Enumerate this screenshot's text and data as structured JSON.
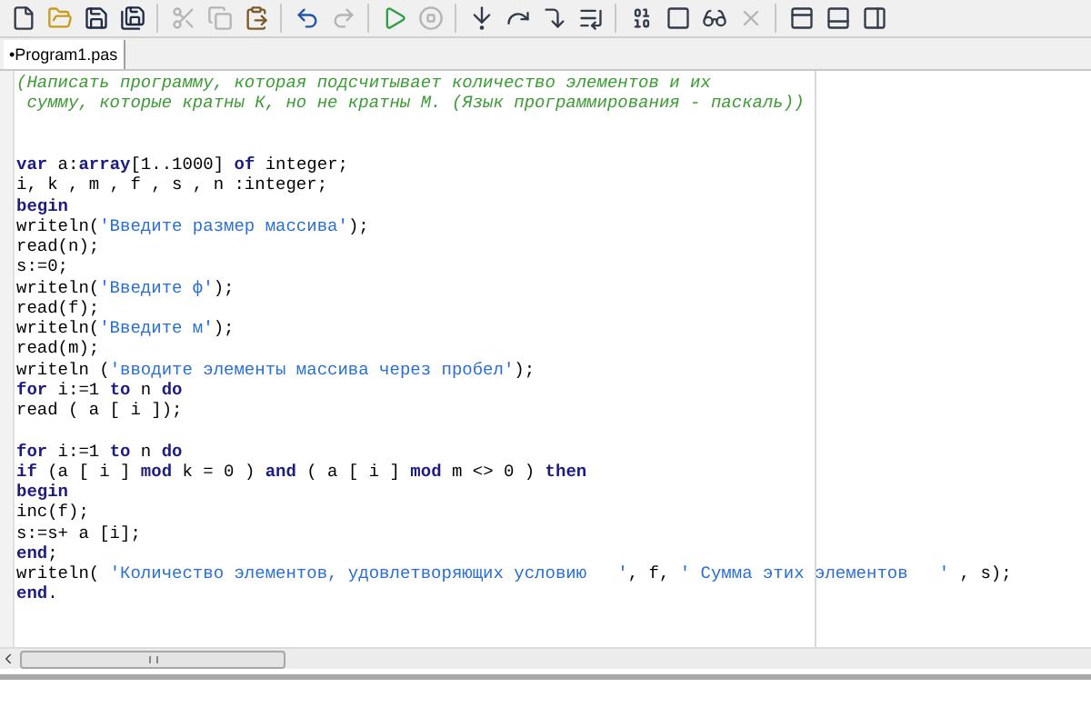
{
  "toolbar": [
    {
      "disabled": false
    },
    {
      "disabled": false
    },
    {
      "disabled": false
    },
    {
      "disabled": false
    },
    {
      "disabled": true
    },
    {
      "disabled": true
    },
    {
      "disabled": false
    },
    {
      "disabled": false
    },
    {
      "disabled": true
    },
    {
      "disabled": false
    },
    {
      "disabled": true
    },
    {
      "disabled": false
    },
    {
      "disabled": false
    },
    {
      "disabled": false
    },
    {
      "disabled": false
    },
    {
      "disabled": false
    },
    {
      "disabled": false
    },
    {
      "disabled": false
    },
    {
      "disabled": true
    },
    {
      "disabled": false
    },
    {
      "disabled": false
    },
    {
      "disabled": false
    }
  ],
  "tabs": [
    {
      "label": "•Program1.pas",
      "selected": true
    }
  ],
  "editor": {
    "lines": [
      {
        "kind": "code",
        "tokens": [
          {
            "kind": "comment",
            "text": "(Написать программу, которая подсчитывает количество элементов и их"
          }
        ]
      },
      {
        "kind": "code",
        "tokens": [
          {
            "kind": "comment",
            "text": " сумму, которые кратны К, но не кратны М. (Язык программирования - паскаль))"
          }
        ]
      },
      {
        "kind": "blank"
      },
      {
        "kind": "blank"
      },
      {
        "kind": "code",
        "tokens": [
          {
            "kind": "keyword",
            "text": "var"
          },
          {
            "kind": "plain",
            "text": " a:"
          },
          {
            "kind": "keyword",
            "text": "array"
          },
          {
            "kind": "plain",
            "text": "[1..1000] "
          },
          {
            "kind": "keyword",
            "text": "of"
          },
          {
            "kind": "plain",
            "text": " integer;"
          }
        ]
      },
      {
        "kind": "code",
        "tokens": [
          {
            "kind": "plain",
            "text": "i, k , m , f , s , n :integer;"
          }
        ]
      },
      {
        "kind": "code",
        "tokens": [
          {
            "kind": "keyword",
            "text": "begin"
          }
        ]
      },
      {
        "kind": "code",
        "tokens": [
          {
            "kind": "plain",
            "text": "writeln("
          },
          {
            "kind": "string",
            "text": "'Введите размер массива'"
          },
          {
            "kind": "plain",
            "text": ");"
          }
        ]
      },
      {
        "kind": "code",
        "tokens": [
          {
            "kind": "plain",
            "text": "read(n);"
          }
        ]
      },
      {
        "kind": "code",
        "tokens": [
          {
            "kind": "plain",
            "text": "s:=0;"
          }
        ]
      },
      {
        "kind": "code",
        "tokens": [
          {
            "kind": "plain",
            "text": "writeln("
          },
          {
            "kind": "string",
            "text": "'Введите ф'"
          },
          {
            "kind": "plain",
            "text": ");"
          }
        ]
      },
      {
        "kind": "code",
        "tokens": [
          {
            "kind": "plain",
            "text": "read(f);"
          }
        ]
      },
      {
        "kind": "code",
        "tokens": [
          {
            "kind": "plain",
            "text": "writeln("
          },
          {
            "kind": "string",
            "text": "'Введите м'"
          },
          {
            "kind": "plain",
            "text": ");"
          }
        ]
      },
      {
        "kind": "code",
        "tokens": [
          {
            "kind": "plain",
            "text": "read(m);"
          }
        ]
      },
      {
        "kind": "code",
        "tokens": [
          {
            "kind": "plain",
            "text": "writeln ("
          },
          {
            "kind": "string",
            "text": "'вводите элементы массива через пробел'"
          },
          {
            "kind": "plain",
            "text": ");"
          }
        ]
      },
      {
        "kind": "code",
        "tokens": [
          {
            "kind": "keyword",
            "text": "for"
          },
          {
            "kind": "plain",
            "text": " i:=1 "
          },
          {
            "kind": "keyword",
            "text": "to"
          },
          {
            "kind": "plain",
            "text": " n "
          },
          {
            "kind": "keyword",
            "text": "do"
          }
        ]
      },
      {
        "kind": "code",
        "tokens": [
          {
            "kind": "plain",
            "text": "read ( a [ i ]);"
          }
        ]
      },
      {
        "kind": "blank"
      },
      {
        "kind": "code",
        "tokens": [
          {
            "kind": "keyword",
            "text": "for"
          },
          {
            "kind": "plain",
            "text": " i:=1 "
          },
          {
            "kind": "keyword",
            "text": "to"
          },
          {
            "kind": "plain",
            "text": " n "
          },
          {
            "kind": "keyword",
            "text": "do"
          }
        ]
      },
      {
        "kind": "code",
        "tokens": [
          {
            "kind": "keyword",
            "text": "if"
          },
          {
            "kind": "plain",
            "text": " (a [ i ] "
          },
          {
            "kind": "keyword",
            "text": "mod"
          },
          {
            "kind": "plain",
            "text": " k = 0 ) "
          },
          {
            "kind": "keyword",
            "text": "and"
          },
          {
            "kind": "plain",
            "text": " ( a [ i ] "
          },
          {
            "kind": "keyword",
            "text": "mod"
          },
          {
            "kind": "plain",
            "text": " m <> 0 ) "
          },
          {
            "kind": "keyword",
            "text": "then"
          }
        ]
      },
      {
        "kind": "code",
        "tokens": [
          {
            "kind": "keyword",
            "text": "begin"
          }
        ]
      },
      {
        "kind": "code",
        "tokens": [
          {
            "kind": "plain",
            "text": "inc(f);"
          }
        ]
      },
      {
        "kind": "code",
        "tokens": [
          {
            "kind": "plain",
            "text": "s:=s+ a [i];"
          }
        ]
      },
      {
        "kind": "code",
        "tokens": [
          {
            "kind": "keyword",
            "text": "end"
          },
          {
            "kind": "plain",
            "text": ";"
          }
        ]
      },
      {
        "kind": "code",
        "tokens": [
          {
            "kind": "plain",
            "text": "writeln( "
          },
          {
            "kind": "string",
            "text": "'Количество элементов, удовлетворяющих условию   '"
          },
          {
            "kind": "plain",
            "text": ", f, "
          },
          {
            "kind": "string",
            "text": "' Сумма этих элементов   '"
          },
          {
            "kind": "plain",
            "text": " , s);"
          }
        ]
      },
      {
        "kind": "code",
        "tokens": [
          {
            "kind": "keyword",
            "text": "end"
          },
          {
            "kind": "plain",
            "text": "."
          }
        ]
      }
    ]
  }
}
